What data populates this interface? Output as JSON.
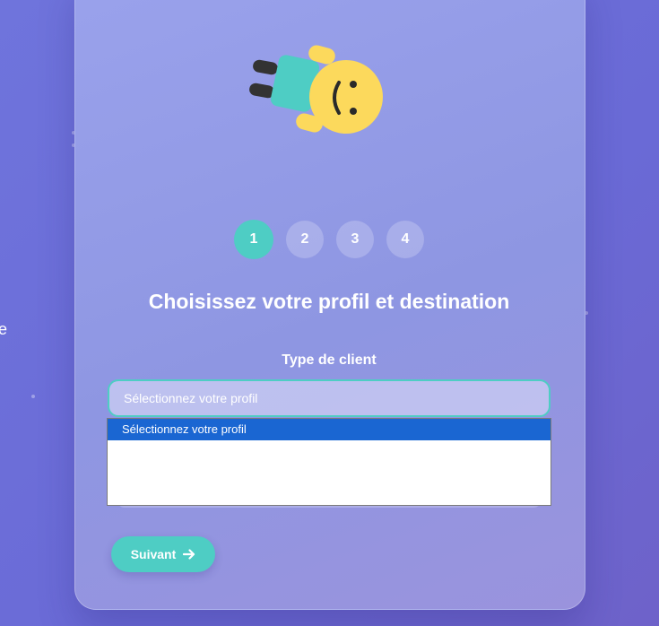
{
  "edge_text": "e",
  "stepper": {
    "steps": [
      "1",
      "2",
      "3",
      "4"
    ],
    "active_index": 0
  },
  "form": {
    "title": "Choisissez votre profil et destination",
    "client_type_label": "Type de client",
    "client_type_value": "Sélectionnez votre profil",
    "client_type_options": [
      "Sélectionnez votre profil"
    ]
  },
  "actions": {
    "next_label": "Suivant"
  },
  "colors": {
    "accent": "#4ecdc4",
    "option_highlight": "#1a66d2",
    "mascot_head": "#fcd95c",
    "mascot_body": "#4ecdc4"
  },
  "icons": {
    "next_icon": "arrow-right-icon",
    "mascot": "mascot-illustration"
  }
}
